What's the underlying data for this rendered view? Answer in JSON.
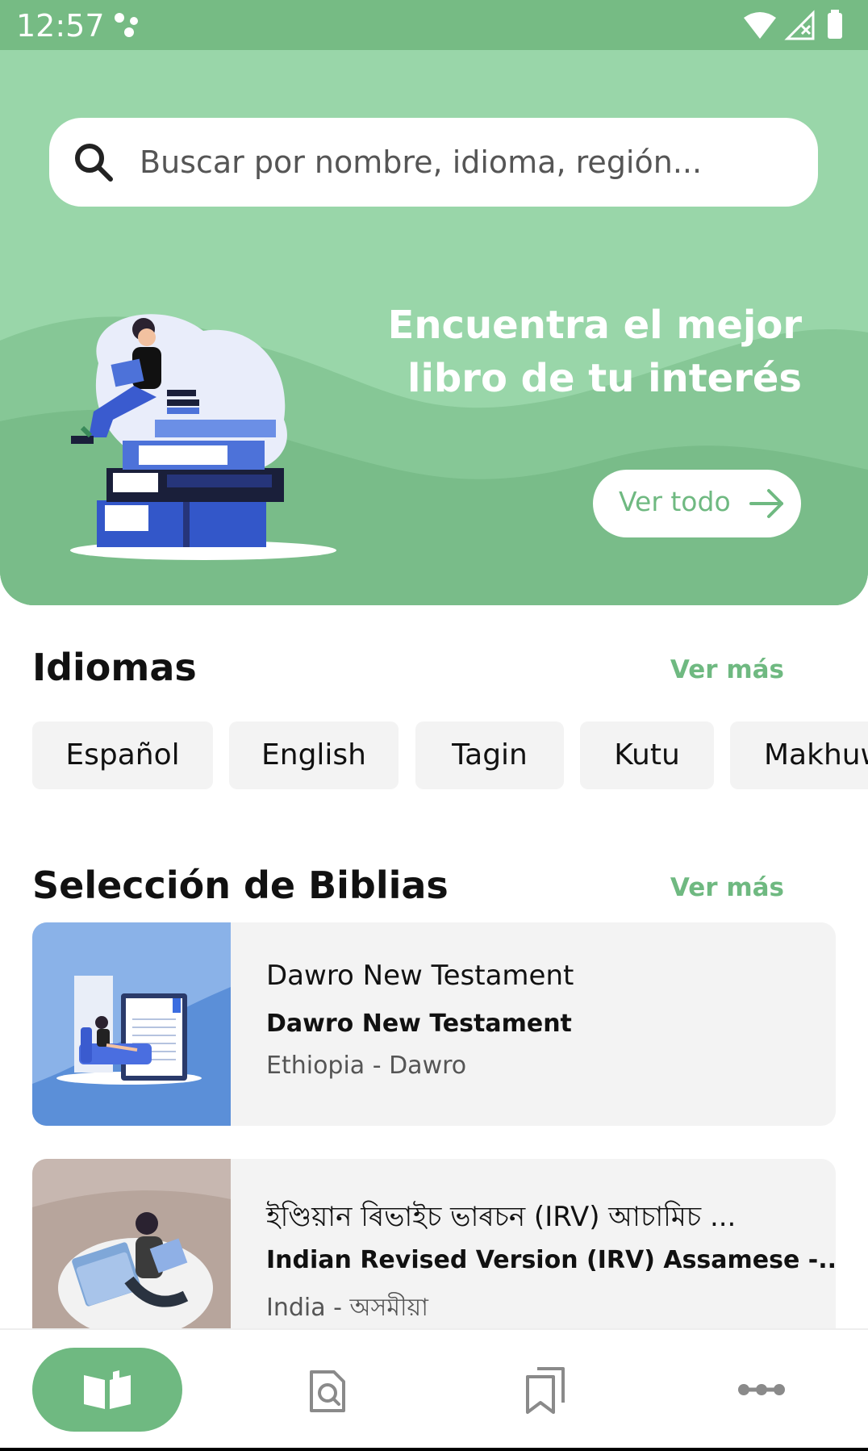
{
  "status_bar": {
    "time": "12:57",
    "background": "#76bb84"
  },
  "search": {
    "placeholder": "Buscar por nombre, idioma, región..."
  },
  "hero": {
    "title_line1": "Encuentra el mejor",
    "title_line2": "libro de tu interés",
    "button_label": "Ver todo",
    "background": "#99d6a9",
    "accent": "#6fb981"
  },
  "languages": {
    "title": "Idiomas",
    "more_label": "Ver más",
    "items": [
      "Español",
      "English",
      "Tagin",
      "Kutu",
      "Makhuwa"
    ]
  },
  "bibles": {
    "title": "Selección de Biblias",
    "more_label": "Ver más",
    "items": [
      {
        "title": "Dawro New Testament",
        "subtitle": "Dawro New Testament",
        "region": "Ethiopia - Dawro"
      },
      {
        "title": "ইণ্ডিয়ান ৰিভাইচ ভাৰচন (IRV) আচামিচ ...",
        "subtitle": "Indian Revised Version (IRV) Assamese -...",
        "region": "India - অসমীয়া"
      }
    ]
  },
  "bottom_nav": {
    "items": [
      {
        "icon": "open-book-icon",
        "active": true
      },
      {
        "icon": "search-document-icon",
        "active": false
      },
      {
        "icon": "bookmarks-icon",
        "active": false
      },
      {
        "icon": "more-icon",
        "active": false
      }
    ]
  }
}
